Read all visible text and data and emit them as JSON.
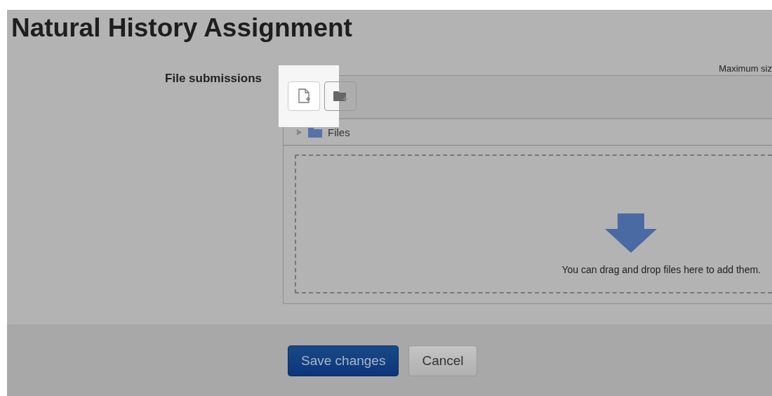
{
  "page": {
    "title": "Natural History Assignment"
  },
  "form": {
    "field_label": "File submissions",
    "max_size": "Maximum siz",
    "toolbar": [
      {
        "kind": "add-file",
        "highlighted": true
      },
      {
        "kind": "create-folder",
        "highlighted": false
      }
    ],
    "tree": [
      {
        "label": "Files",
        "expanded": false
      }
    ],
    "drop_hint": "You can drag and drop files here to add them."
  },
  "buttons": [
    {
      "label": "Save changes",
      "kind": "primary"
    },
    {
      "label": "Cancel",
      "kind": "secondary"
    }
  ]
}
